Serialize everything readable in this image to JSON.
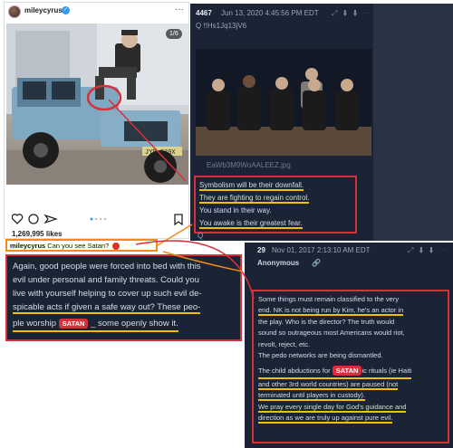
{
  "instagram": {
    "username": "mileycyrus",
    "counter": "1/6",
    "likes": "1,269,995 likes",
    "caption_user": "mileycyrus",
    "caption_text": "Can you see Satan?",
    "license_plate": "JYD 839X"
  },
  "q_post_top": {
    "number": "4467",
    "date": "Jun 13, 2020 4:45:56 PM EDT",
    "id": "Q  !!Hs1Jq13jV6",
    "filename": "EaWb3M9WoAALEEZ.jpg",
    "lines": [
      "Symbolism will be their downfall.",
      "They are fighting to regain control.",
      "You stand in their way.",
      "You awake is their greatest fear."
    ],
    "trailing": "Q"
  },
  "left_quote": {
    "line1": "Again, good people were forced into bed with this",
    "line2": "evil under personal and family threats. Could you",
    "line3": "live with yourself helping to cover up such evil de-",
    "line4": "spicable acts if given a safe way out? These peo-",
    "line5_pre": "ple worship",
    "tag": "SATAN",
    "line5_post": "_ some openly show it."
  },
  "q_post_bottom": {
    "number": "29",
    "date": "Nov 01, 2017 2:13:10 AM EDT",
    "name": "Anonymous",
    "lines": [
      "Some things must remain classified to the very",
      "end. NK is not being run by Kim, he's an actor in",
      "the play. Who is the director? The truth would",
      "sound so outrageous most Americans would riot,",
      "revolt, reject, etc.",
      "The pedo networks are being dismantled.",
      "The child abductions for",
      "ic rituals (ie Haiti",
      "and other 3rd world countries) are paused (not",
      "terminated until players in custody).",
      "We pray every single day for God's guidance and",
      "direction as we are truly up against pure evil."
    ],
    "tag": "SATAN"
  },
  "colors": {
    "panel_dark": "#1b2434",
    "highlight_red": "#d8303a",
    "underline_yellow": "#f2c000",
    "caption_orange": "#f28a1c"
  }
}
